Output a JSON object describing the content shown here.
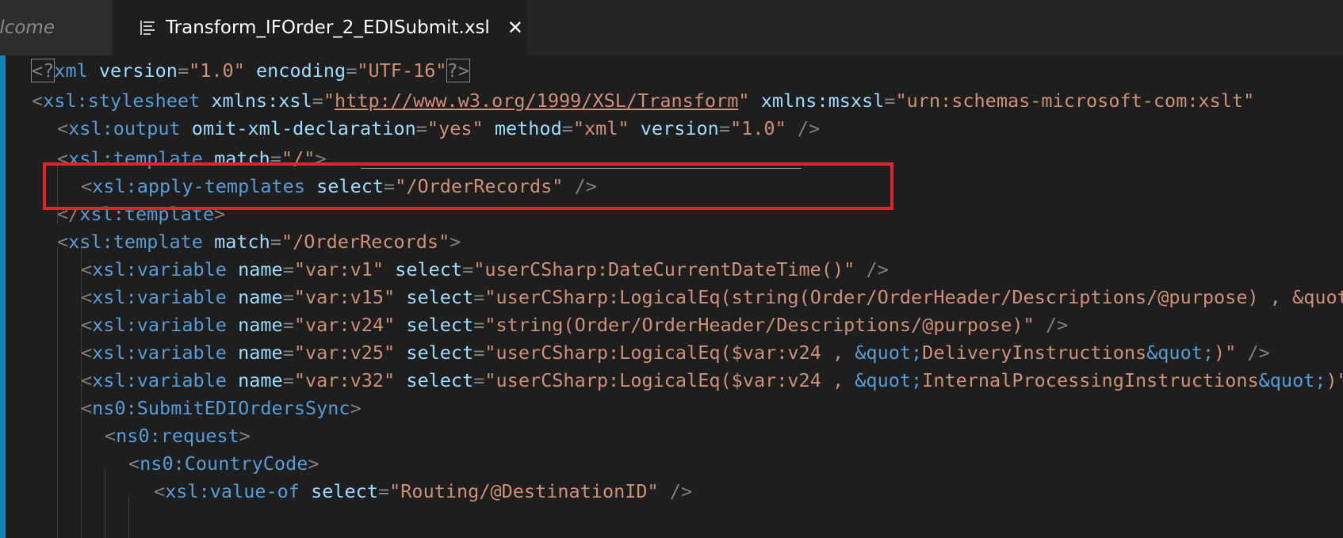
{
  "tabs": [
    {
      "label": "elcome",
      "active": false
    },
    {
      "label": "Transform_IFOrder_2_EDISubmit.xsl",
      "active": true,
      "close": "✕"
    }
  ],
  "colors": {
    "tag": "#569cd6",
    "attribute": "#9cdcfe",
    "value": "#ce9178",
    "punctuation": "#808080",
    "highlight_border": "#e0242b",
    "gutter_accent": "#1183b5"
  },
  "code": {
    "l1": {
      "p1": "<?",
      "tag": "xml",
      "a1": "version",
      "v1": "\"1.0\"",
      "a2": "encoding",
      "v2": "\"UTF-16\"",
      "p2": "?>"
    },
    "l2": {
      "p1": "<",
      "tag": "xsl:stylesheet",
      "a1": "xmlns:xsl",
      "v1q": "\"",
      "v1": "http://www.w3.org/1999/XSL/Transform",
      "v1q2": "\"",
      "a2": "xmlns:msxsl",
      "v2": "\"urn:schemas-microsoft-com:xslt\""
    },
    "l3": {
      "p1": "<",
      "tag": "xsl:output",
      "a1": "omit-xml-declaration",
      "v1": "\"yes\"",
      "a2": "method",
      "v2": "\"xml\"",
      "a3": "version",
      "v3": "\"1.0\"",
      "p2": "/>"
    },
    "l4": {
      "p1": "<",
      "tag": "xsl:template",
      "a1": "match",
      "v1": "\"/\"",
      "p2": ">"
    },
    "l5": {
      "p1": "<",
      "tag": "xsl:apply-templates",
      "a1": "select",
      "v1": "\"/OrderRecords\"",
      "p2": "/>"
    },
    "l6": {
      "p1": "</",
      "tag": "xsl:template",
      "p2": ">"
    },
    "l7": {
      "p1": "<",
      "tag": "xsl:template",
      "a1": "match",
      "v1": "\"/OrderRecords\"",
      "p2": ">"
    },
    "l8": {
      "p1": "<",
      "tag": "xsl:variable",
      "a1": "name",
      "v1": "\"var:v1\"",
      "a2": "select",
      "v2": "\"userCSharp:DateCurrentDateTime()\"",
      "p2": "/>"
    },
    "l9": {
      "p1": "<",
      "tag": "xsl:variable",
      "a1": "name",
      "v1": "\"var:v15\"",
      "a2": "select",
      "v2": "\"userCSharp:LogicalEq(string(Order/OrderHeader/Descriptions/@purpose) , &quot;DeliveryInstructions&quot;)\""
    },
    "l10": {
      "p1": "<",
      "tag": "xsl:variable",
      "a1": "name",
      "v1": "\"var:v24\"",
      "a2": "select",
      "v2": "\"string(Order/OrderHeader/Descriptions/@purpose)\"",
      "p2": "/>"
    },
    "l11": {
      "p1": "<",
      "tag": "xsl:variable",
      "a1": "name",
      "v1": "\"var:v25\"",
      "a2": "select",
      "v2a": "\"userCSharp:LogicalEq($var:v24 , ",
      "ent1": "&quot;",
      "v2b": "DeliveryInstructions",
      "ent2": "&quot;",
      "v2c": ")\"",
      "p2": "/>"
    },
    "l12": {
      "p1": "<",
      "tag": "xsl:variable",
      "a1": "name",
      "v1": "\"var:v32\"",
      "a2": "select",
      "v2a": "\"userCSharp:LogicalEq($var:v24 , ",
      "ent1": "&quot;",
      "v2b": "InternalProcessingInstructions",
      "ent2": "&quot;",
      "v2c": ")\"",
      "p2": "/>"
    },
    "l13": {
      "p1": "<",
      "tag": "ns0:SubmitEDIOrdersSync",
      "p2": ">"
    },
    "l14": {
      "p1": "<",
      "tag": "ns0:request",
      "p2": ">"
    },
    "l15": {
      "p1": "<",
      "tag": "ns0:CountryCode",
      "p2": ">"
    },
    "l16": {
      "p1": "<",
      "tag": "xsl:value-of",
      "a1": "select",
      "v1": "\"Routing/@DestinationID\"",
      "p2": "/>"
    }
  }
}
